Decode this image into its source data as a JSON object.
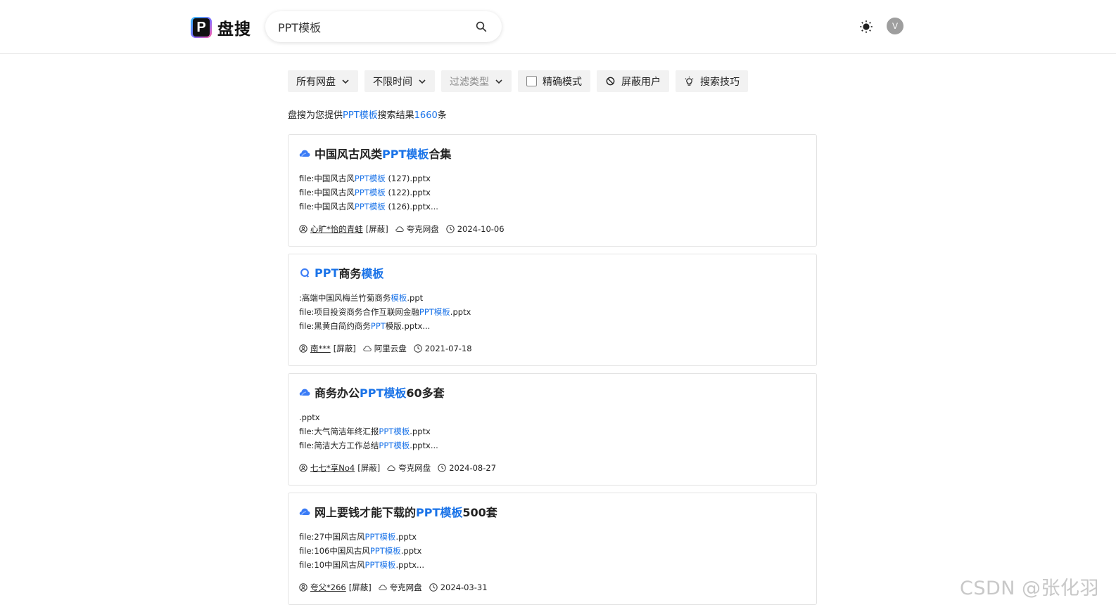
{
  "brand": {
    "name": "盘搜",
    "mark": "P"
  },
  "search": {
    "value": "PPT模板"
  },
  "user": {
    "avatar_initial": "V"
  },
  "filters": {
    "disk": "所有网盘",
    "time": "不限时间",
    "type": "过滤类型",
    "precise": "精确模式",
    "block": "屏蔽用户",
    "tips": "搜索技巧"
  },
  "summary": {
    "prefix": "盘搜为您提供",
    "keyword": "PPT模板",
    "middle": "搜索结果",
    "count": "1660",
    "suffix": "条"
  },
  "results": [
    {
      "title_pre": "中国风古风类",
      "title_hl": "PPT模板",
      "title_post": "合集",
      "icon": "quark-cloud-icon",
      "files": [
        {
          "pre": "file:中国风古风",
          "hl": "PPT模板",
          "post": " (127).pptx"
        },
        {
          "pre": "file:中国风古风",
          "hl": "PPT模板",
          "post": " (122).pptx"
        },
        {
          "pre": "file:中国风古风",
          "hl": "PPT模板",
          "post": " (126).pptx..."
        }
      ],
      "user": "心旷*怡的青蛙",
      "block": "[屏蔽]",
      "disk": "夸克网盘",
      "date": "2024-10-06"
    },
    {
      "title_pre": "",
      "title_hl": "PPT",
      "title_mid": "商务",
      "title_hl2": "模板",
      "title_post": "",
      "icon": "aliyun-ring-icon",
      "files": [
        {
          "pre": ":高端中国风梅兰竹菊商务",
          "hl": "模板",
          "post": ".ppt"
        },
        {
          "pre": "file:项目投资商务合作互联网金融",
          "hl": "PPT模板",
          "post": ".pptx"
        },
        {
          "pre": "file:黑黄白简约商务",
          "hl": "PPT",
          "post": "模版.pptx..."
        }
      ],
      "user": "南***",
      "block": "[屏蔽]",
      "disk": "阿里云盘",
      "date": "2021-07-18"
    },
    {
      "title_pre": "商务办公",
      "title_hl": "PPT模板",
      "title_post": "60多套",
      "icon": "quark-cloud-icon",
      "files": [
        {
          "pre": ".pptx",
          "hl": "",
          "post": ""
        },
        {
          "pre": "file:大气简洁年终汇报",
          "hl": "PPT模板",
          "post": ".pptx"
        },
        {
          "pre": "file:简洁大方工作总结",
          "hl": "PPT模板",
          "post": ".pptx..."
        }
      ],
      "user": "七七*享No4",
      "block": "[屏蔽]",
      "disk": "夸克网盘",
      "date": "2024-08-27"
    },
    {
      "title_pre": "网上要钱才能下载的",
      "title_hl": "PPT模板",
      "title_post": "500套",
      "icon": "quark-cloud-icon",
      "files": [
        {
          "pre": "file:27中国风古风",
          "hl": "PPT模板",
          "post": ".pptx"
        },
        {
          "pre": "file:106中国风古风",
          "hl": "PPT模板",
          "post": ".pptx"
        },
        {
          "pre": "file:10中国风古风",
          "hl": "PPT模板",
          "post": ".pptx..."
        }
      ],
      "user": "夸父*266",
      "block": "[屏蔽]",
      "disk": "夸克网盘",
      "date": "2024-03-31"
    }
  ],
  "watermark": "CSDN @张化羽"
}
